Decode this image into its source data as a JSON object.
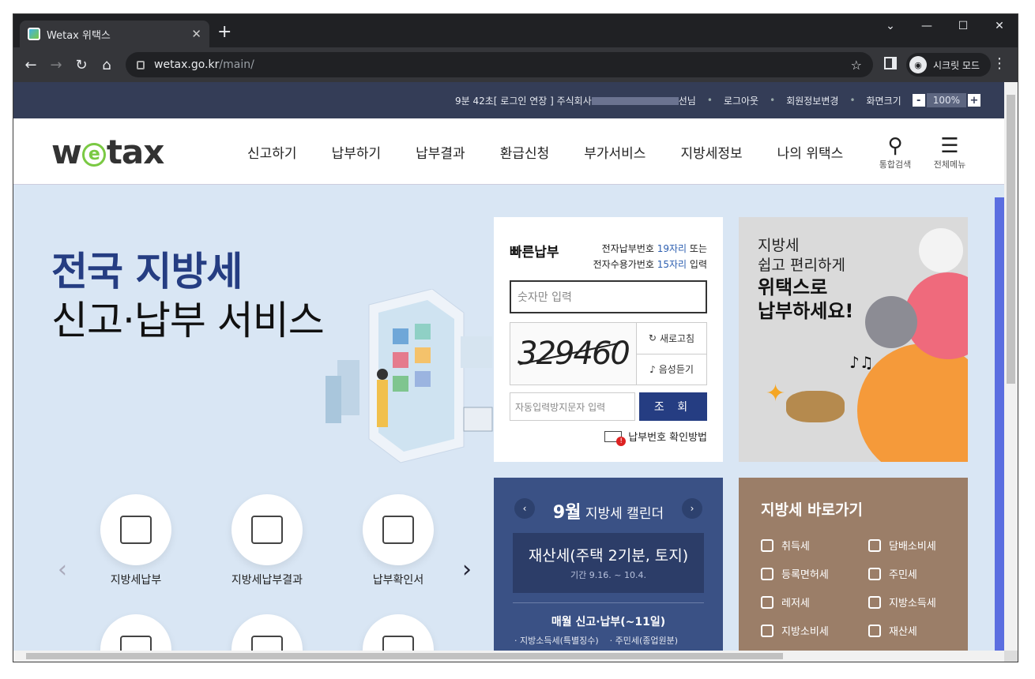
{
  "browser": {
    "tab_title": "Wetax 위택스",
    "url_host": "wetax.go.kr",
    "url_path": "/main/",
    "incognito_label": "시크릿 모드"
  },
  "topbar": {
    "session": "9분 42초[ 로그인 연장 ] 주식회사",
    "user_suffix": "선님",
    "logout": "로그아웃",
    "member_edit": "회원정보변경",
    "zoom_label": "화면크기",
    "zoom_minus": "-",
    "zoom_value": "100%",
    "zoom_plus": "+"
  },
  "header": {
    "logo_w": "w",
    "logo_e": "e",
    "logo_rest": "tax",
    "nav": [
      "신고하기",
      "납부하기",
      "납부결과",
      "환급신청",
      "부가서비스",
      "지방세정보",
      "나의 위택스"
    ],
    "search_label": "통합검색",
    "menu_label": "전체메뉴"
  },
  "hero": {
    "line1": "전국 지방세",
    "line2": "신고·납부 서비스"
  },
  "quick_pay": {
    "title": "빠른납부",
    "desc1_a": "전자납부번호 ",
    "desc1_b": "19자리",
    "desc1_c": " 또는",
    "desc2_a": "전자수용가번호 ",
    "desc2_b": "15자리",
    "desc2_c": " 입력",
    "input_placeholder": "숫자만 입력",
    "captcha_text": "329460",
    "refresh": "새로고침",
    "audio": "음성듣기",
    "captcha_placeholder": "자동입력방지문자 입력",
    "submit": "조 회",
    "help": "납부번호 확인방법"
  },
  "promo": {
    "line1": "지방세",
    "line2": "쉽고 편리하게",
    "line3": "위택스로",
    "line4": "납부하세요!"
  },
  "calendar": {
    "month": "9월",
    "title": " 지방세 캘린더",
    "prev": "‹",
    "next": "›",
    "event_title": "재산세(주택 2기분, 토지)",
    "event_period": "기간 9.16. ~ 10.4.",
    "monthly": "매월 신고·납부(~11일)",
    "items": [
      "· 지방소득세(특별징수)",
      "· 주민세(종업원분)"
    ]
  },
  "shortcut": {
    "title": "지방세 바로가기",
    "items": [
      "취득세",
      "담배소비세",
      "등록면허세",
      "주민세",
      "레저세",
      "지방소득세",
      "지방소비세",
      "재산세"
    ]
  },
  "services": {
    "labels": [
      "지방세납부",
      "지방세납부결과",
      "납부확인서"
    ]
  },
  "colors": {
    "navy": "#343d57",
    "brand_blue": "#253d82",
    "accent_green": "#7ac943",
    "calendar_bg": "#3a5185",
    "shortcut_bg": "#9b7e68"
  }
}
